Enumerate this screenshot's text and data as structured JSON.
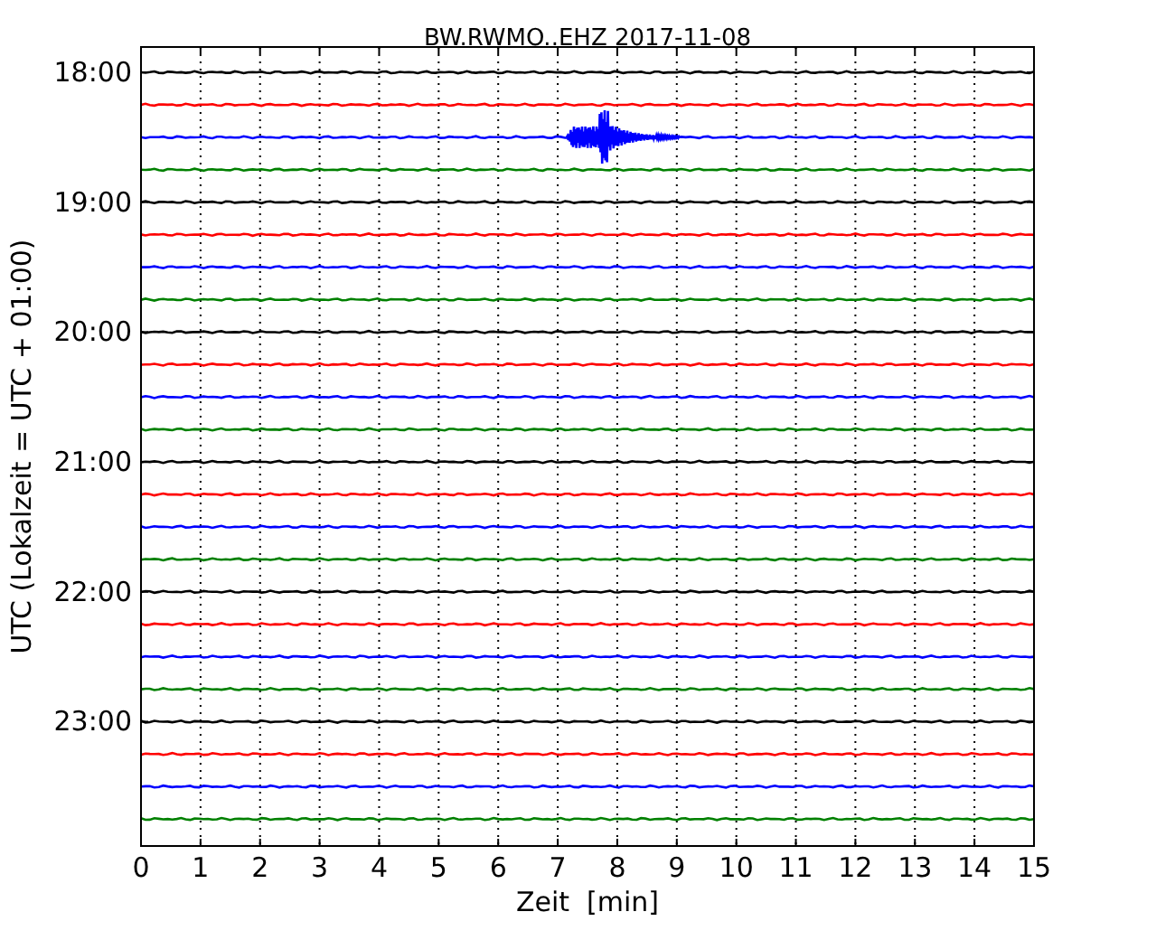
{
  "title": "BW.RWMO..EHZ 2017-11-08",
  "xlabel": "Zeit  [min]",
  "ylabel": "UTC (Lokalzeit = UTC + 01:00)",
  "xticks": [
    "0",
    "1",
    "2",
    "3",
    "4",
    "5",
    "6",
    "7",
    "8",
    "9",
    "10",
    "11",
    "12",
    "13",
    "14",
    "15"
  ],
  "traces": [
    {
      "label": "18:00",
      "color": "#000000",
      "event": false
    },
    {
      "color": "#ff0000",
      "event": false
    },
    {
      "color": "#0000ff",
      "event": true
    },
    {
      "color": "#008000",
      "event": false
    },
    {
      "label": "19:00",
      "color": "#000000",
      "event": false
    },
    {
      "color": "#ff0000",
      "event": false
    },
    {
      "color": "#0000ff",
      "event": false
    },
    {
      "color": "#008000",
      "event": false
    },
    {
      "label": "20:00",
      "color": "#000000",
      "event": false
    },
    {
      "color": "#ff0000",
      "event": false
    },
    {
      "color": "#0000ff",
      "event": false
    },
    {
      "color": "#008000",
      "event": false
    },
    {
      "label": "21:00",
      "color": "#000000",
      "event": false
    },
    {
      "color": "#ff0000",
      "event": false
    },
    {
      "color": "#0000ff",
      "event": false
    },
    {
      "color": "#008000",
      "event": false
    },
    {
      "label": "22:00",
      "color": "#000000",
      "event": false
    },
    {
      "color": "#ff0000",
      "event": false
    },
    {
      "color": "#0000ff",
      "event": false
    },
    {
      "color": "#008000",
      "event": false
    },
    {
      "label": "23:00",
      "color": "#000000",
      "event": false
    },
    {
      "color": "#ff0000",
      "event": false
    },
    {
      "color": "#0000ff",
      "event": false
    },
    {
      "color": "#008000",
      "event": false
    }
  ]
}
